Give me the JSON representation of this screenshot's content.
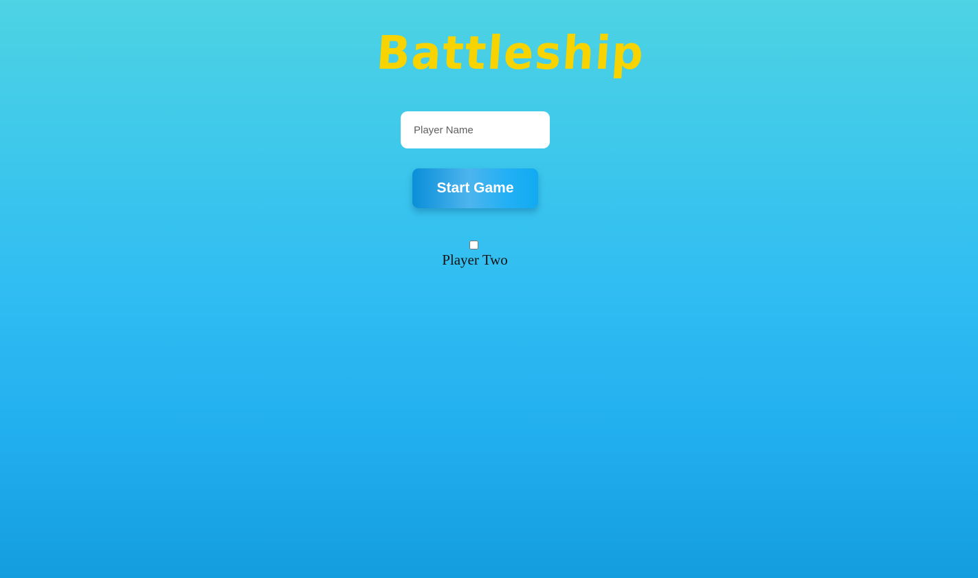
{
  "app": {
    "title": "Battleship"
  },
  "form": {
    "player_name": {
      "value": "",
      "placeholder": "Player Name"
    },
    "start_button_label": "Start Game",
    "player_two": {
      "checked": false,
      "label": "Player Two"
    }
  },
  "colors": {
    "title": "#f7d400",
    "background_top": "#4dd3e3",
    "background_bottom": "#139ddf",
    "button": "#23b0f4"
  }
}
